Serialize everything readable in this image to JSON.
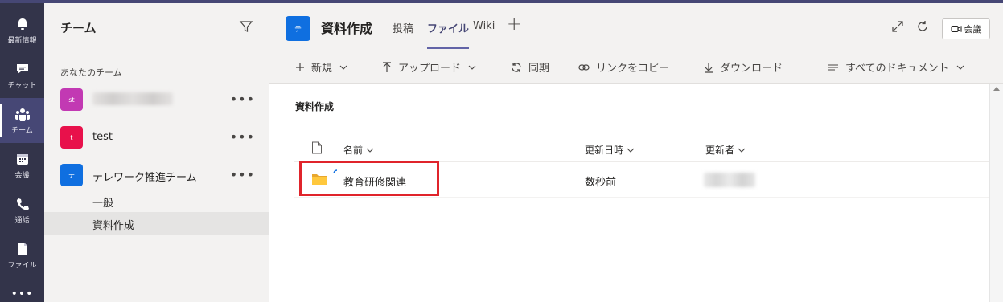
{
  "rail": {
    "items": [
      {
        "label": "最新情報",
        "icon": "bell-icon"
      },
      {
        "label": "チャット",
        "icon": "chat-icon"
      },
      {
        "label": "チーム",
        "icon": "teams-icon",
        "active": true
      },
      {
        "label": "会議",
        "icon": "calendar-icon"
      },
      {
        "label": "通話",
        "icon": "phone-icon"
      },
      {
        "label": "ファイル",
        "icon": "file-icon"
      }
    ],
    "more": "•••"
  },
  "teams_pane": {
    "title": "チーム",
    "section_label": "あなたのチーム",
    "teams": [
      {
        "avatar": "st",
        "name": "",
        "avatar_color": "#c239b3",
        "more": "•••"
      },
      {
        "avatar": "t",
        "name": "test",
        "avatar_color": "#e8114b",
        "more": "•••"
      },
      {
        "avatar": "テ",
        "name": "テレワーク推進チーム",
        "avatar_color": "#0f6fe0",
        "more": "•••"
      }
    ],
    "channels": [
      {
        "label": "一般"
      },
      {
        "label": "資料作成",
        "selected": true
      }
    ]
  },
  "header": {
    "avatar": "テ",
    "title": "資料作成",
    "tabs": [
      {
        "label": "投稿"
      },
      {
        "label": "ファイル",
        "active": true
      },
      {
        "label": "Wiki"
      }
    ],
    "add_tab": "+",
    "meet_label": "会議"
  },
  "commands": {
    "new": "新規",
    "upload": "アップロード",
    "sync": "同期",
    "copy_link": "リンクをコピー",
    "download": "ダウンロード",
    "view": "すべてのドキュメント"
  },
  "files": {
    "folder_title": "資料作成",
    "columns": {
      "name": "名前",
      "modified": "更新日時",
      "modified_by": "更新者"
    },
    "rows": [
      {
        "name": "教育研修関連",
        "modified": "数秒前",
        "modified_by": ""
      }
    ]
  },
  "colors": {
    "brand": "#6264a7",
    "rail": "#33344a",
    "highlight": "#e0242b"
  }
}
